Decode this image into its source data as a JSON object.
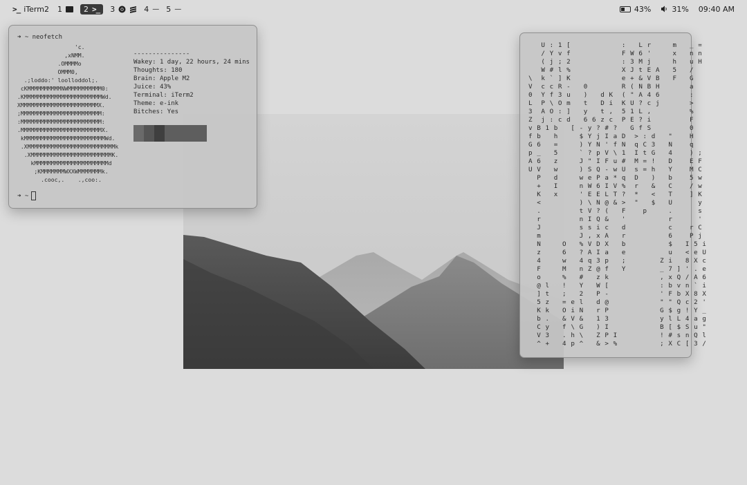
{
  "menubar": {
    "app_name": "iTerm2",
    "workspaces": [
      {
        "label": "1"
      },
      {
        "label": "2"
      },
      {
        "label": "3"
      },
      {
        "label": "4",
        "suffix": "—"
      },
      {
        "label": "5",
        "suffix": "—"
      }
    ],
    "battery": "43%",
    "volume": "31%",
    "clock": "09:40 AM"
  },
  "terminal_left": {
    "command": "➜  ~ neofetch",
    "ascii_art": "                 'c.\n              ,xNMM.\n            .OMMMMo\n            OMMM0,\n  .;loddo:' loolloddol;.\n cKMMMMMMMMMMNWMMMMMMMMMM0:\n.KMMMMMMMMMMMMMMMMMMMMMMMWd.\nXMMMMMMMMMMMMMMMMMMMMMMMX.\n;MMMMMMMMMMMMMMMMMMMMMMMM:\n:MMMMMMMMMMMMMMMMMMMMMMMM:\n.MMMMMMMMMMMMMMMMMMMMMMMMX.\n kMMMMMMMMMMMMMMMMMMMMMMMMWd.\n .XMMMMMMMMMMMMMMMMMMMMMMMMMMk\n  .XMMMMMMMMMMMMMMMMMMMMMMMMK.\n    kMMMMMMMMMMMMMMMMMMMMMMd\n     ;KMMMMMMMWXXWMMMMMMMk.\n       .cooc,.    .,coo:.",
    "separator": "---------------",
    "info": [
      {
        "key": "Wakey",
        "value": "1 day, 22 hours, 24 mins"
      },
      {
        "key": "Thoughts",
        "value": "180"
      },
      {
        "key": "Brain",
        "value": "Apple M2"
      },
      {
        "key": "Juice",
        "value": "43%"
      },
      {
        "key": "Terminal",
        "value": "iTerm2"
      },
      {
        "key": "Theme",
        "value": "e-ink"
      },
      {
        "key": "Bitches",
        "value": "Yes"
      }
    ],
    "palette_colors": [
      "#6a6a6a",
      "#555555",
      "#3f3f3f",
      "#5e5e5e"
    ],
    "prompt": "➜  ~"
  },
  "terminal_right": {
    "matrix_text": "   U : 1 [            :   L r     m   _ =\n   / Y v f            F W 6 '     x   n n\n   ( j ; 2            : 3 M j     h   u H\n   W # l %            X J t E A   5   /\n\\  k ` ] K            e + & V B   F   G\nV  c c R -   0        R ( N B H       a\n0  Y f 3 u   )   d K  ( \" A 4 6       :\nL  P \\ O m   t   D i  K U ? c j       >\n3  A O : ]   y   t ,  5 1 L ,         %\nZ  j : c d   6 6 z c  P E ? i         F\nv B 1 b   [ - y ? # ?   G f S         0\nf b   h     $ Y j I a D  > : d   \"    H\nG 6   =     ) Y N ' f N  q C 3   N    q\np _   5     ` ? p V \\ 1  I t G   4    ) ;\nA 6   z     J \" I F u #  M = !   D    E F\nU V   w     ) S Q - w U  s = h   Y    M C\n  P   d     w e P a * q  D   )   b    5 w\n  +   I     n W 6 I V %  r   &   C    / w\n  K   x     ' E E L T ?  *   <   T    ] K\n  <         ) \\ N @ & >  \"   $   U      y\n  .         t V ? (   F    p     .      s\n  r         n I Q &   '          r      '\n  J         s s i c   d          c    r C\n  m         J , x A   r          6    P j\n  N     O   % V D X   b          $   I 5 i\n  z     6   ? A I a   e          u   < e U\n  4     w   4 q 3 p   ;        Z i   8 X c\n  F     M   n Z @ f   Y        _ 7 ] ' . e\n  o     %   #   z k            , x Q / A 6\n  @ l   !   Y   W [            : b v n ` i\n  ] t   ;   2   P -            ' F b X 8 X\n  5 z   = e l   d @            \" \" Q c 2 '\n  K k   O i N   r P            G $ g ! Y _\n  b .   & V &   1 3            y l L 4 a g\n  C y   f \\ G   ) I            B [ $ S u \"\n  V 3   . h \\   Z P I          ! # s n Q l\n  ^ +   4 p ^   & > %          ; X C [ 3 /"
  }
}
